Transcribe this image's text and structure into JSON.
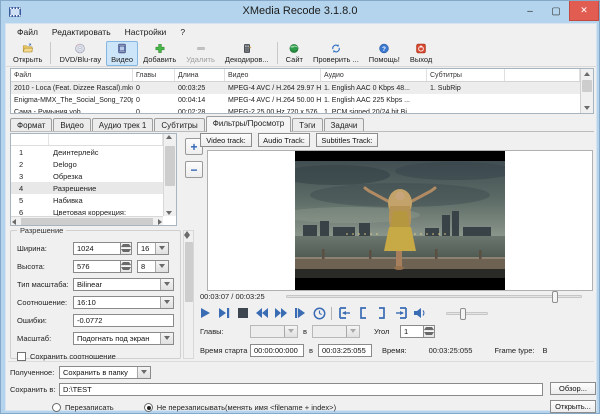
{
  "window": {
    "title": "XMedia Recode 3.1.8.0",
    "minimize": "–",
    "maximize": "▢",
    "close": "✕"
  },
  "menu": {
    "items": [
      {
        "label": "Файл"
      },
      {
        "label": "Редактировать"
      },
      {
        "label": "Настройки"
      },
      {
        "label": "?"
      }
    ]
  },
  "toolbar": {
    "buttons": [
      {
        "label": "Открыть",
        "icon": "open-folder-icon"
      },
      {
        "label": "DVD/Blu-ray",
        "icon": "disc-icon"
      },
      {
        "label": "Видео",
        "icon": "film-icon",
        "selected": true
      },
      {
        "label": "Добавить",
        "icon": "add-plus-icon"
      },
      {
        "label": "Удалить",
        "icon": "remove-minus-icon",
        "disabled": true
      },
      {
        "label": "Декодиров...",
        "icon": "decode-icon"
      },
      {
        "label": "Сайт",
        "icon": "globe-icon"
      },
      {
        "label": "Проверить ...",
        "icon": "refresh-icon"
      },
      {
        "label": "Помощь!",
        "icon": "help-icon"
      },
      {
        "label": "Выход",
        "icon": "power-icon"
      }
    ]
  },
  "file_table": {
    "columns": [
      "Файл",
      "Главы",
      "Длина",
      "Видео",
      "Аудио",
      "Субтитры"
    ],
    "rows": [
      {
        "file": "2010 - Loca (Feat. Dizzee Rascal).mkv",
        "chapters": "0",
        "length": "00:03:25",
        "video": "MPEG-4 AVC / H.264 29.97 H...",
        "audio": "1. English AAC  0 Kbps 48...",
        "subtitles": "1. SubRip"
      },
      {
        "file": "Enigma-MMX_The_Social_Song_720p...",
        "chapters": "0",
        "length": "00:04:14",
        "video": "MPEG-4 AVC / H.264 50.00 H...",
        "audio": "1. English AAC  225 Kbps ...",
        "subtitles": ""
      },
      {
        "file": "Сама - Румыния.vob",
        "chapters": "0",
        "length": "00:02:28",
        "video": "MPEG-2 25.00 Hz  720 x 576...",
        "audio": "1. PCM signed 20/24 bit Bi...",
        "subtitles": ""
      }
    ]
  },
  "tabs": {
    "items": [
      {
        "label": "Формат"
      },
      {
        "label": "Видео"
      },
      {
        "label": "Аудио трек 1"
      },
      {
        "label": "Субтитры"
      },
      {
        "label": "Фильтры/Просмотр",
        "active": true
      },
      {
        "label": "Тэги"
      },
      {
        "label": "Задачи"
      }
    ]
  },
  "filters": {
    "add_label": "+",
    "remove_label": "−",
    "items": [
      {
        "num": "1",
        "label": "Деинтерлейс"
      },
      {
        "num": "2",
        "label": "Delogo"
      },
      {
        "num": "3",
        "label": "Обрезка"
      },
      {
        "num": "4",
        "label": "Разрешение",
        "selected": true
      },
      {
        "num": "5",
        "label": "Набивка"
      },
      {
        "num": "6",
        "label": "Цветовая коррекция:"
      }
    ]
  },
  "resolution": {
    "group_title": "Разрешение",
    "width_label": "Ширина:",
    "width_value": "1024",
    "width_mod": "16",
    "height_label": "Высота:",
    "height_value": "576",
    "height_mod": "8",
    "scale_type_label": "Тип масштаба:",
    "scale_type_value": "Bilinear",
    "ratio_label": "Соотношение:",
    "ratio_value": "16:10",
    "error_label": "Ошибки:",
    "error_value": "-0.0772",
    "zoom_label": "Масштаб:",
    "zoom_value": "Подогнать под экран",
    "keep_ratio_label": "Сохранить соотношение"
  },
  "preview": {
    "video_track_btn": "Video track:",
    "audio_track_btn": "Audio Track:",
    "subtitles_track_btn": "Subtitles Track:",
    "time_display": "00:03:07 / 00:03:25",
    "player_icons": [
      "play-icon",
      "next-frame-icon",
      "stop-icon",
      "rewind-icon",
      "forward-icon",
      "step-forward-icon",
      "clock-icon",
      "mark-in-icon",
      "bracket-open-icon",
      "bracket-close-icon",
      "mark-out-icon",
      "volume-icon"
    ]
  },
  "player": {
    "chapters_label": "Главы:",
    "between_label": "в",
    "angle_label": "Угол",
    "angle_value": "1",
    "start_label": "Время старта",
    "start_value": "00:00:00:000",
    "end_value": "00:03:25:055",
    "time_label": "Время:",
    "time_value": "00:03:25:055",
    "frame_type_label": "Frame type:",
    "frame_type_value": "B"
  },
  "output": {
    "mode_label": "Полученное:",
    "mode_value": "Сохранить в папку",
    "save_label": "Сохранить в:",
    "save_value": "D:\\TEST",
    "browse_btn": "Обзор...",
    "open_btn": "Открыть...",
    "overwrite_label": "Перезаписать",
    "no_overwrite_label": "Не перезаписывать(менять имя <filename + index>)"
  },
  "colors": {
    "titlebar": "#b3d4ec",
    "close_button": "#e25d51",
    "selection_blue": "#cde5f9",
    "player_icon_blue": "#3a6cb4",
    "add_green": "#3fae3f",
    "exit_red": "#d6452c"
  }
}
